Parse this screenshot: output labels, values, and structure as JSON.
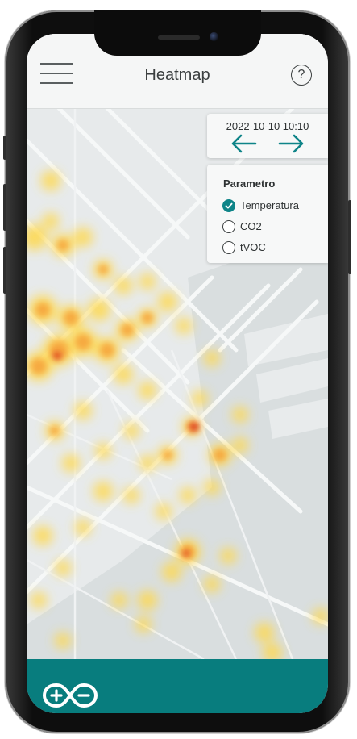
{
  "header": {
    "title": "Heatmap",
    "help_label": "?"
  },
  "date_panel": {
    "datetime": "2022-10-10 10:10"
  },
  "parameter_panel": {
    "title": "Parametro",
    "options": [
      {
        "label": "Temperatura",
        "selected": true
      },
      {
        "label": "CO2",
        "selected": false
      },
      {
        "label": "tVOC",
        "selected": false
      }
    ]
  },
  "colors": {
    "accent": "#0e8488",
    "footer": "#087d7e",
    "header_bg": "#f5f6f6"
  },
  "icons": {
    "menu": "hamburger-icon",
    "help": "question-icon",
    "prev": "arrow-left-icon",
    "next": "arrow-right-icon",
    "brand": "arduino-logo"
  }
}
